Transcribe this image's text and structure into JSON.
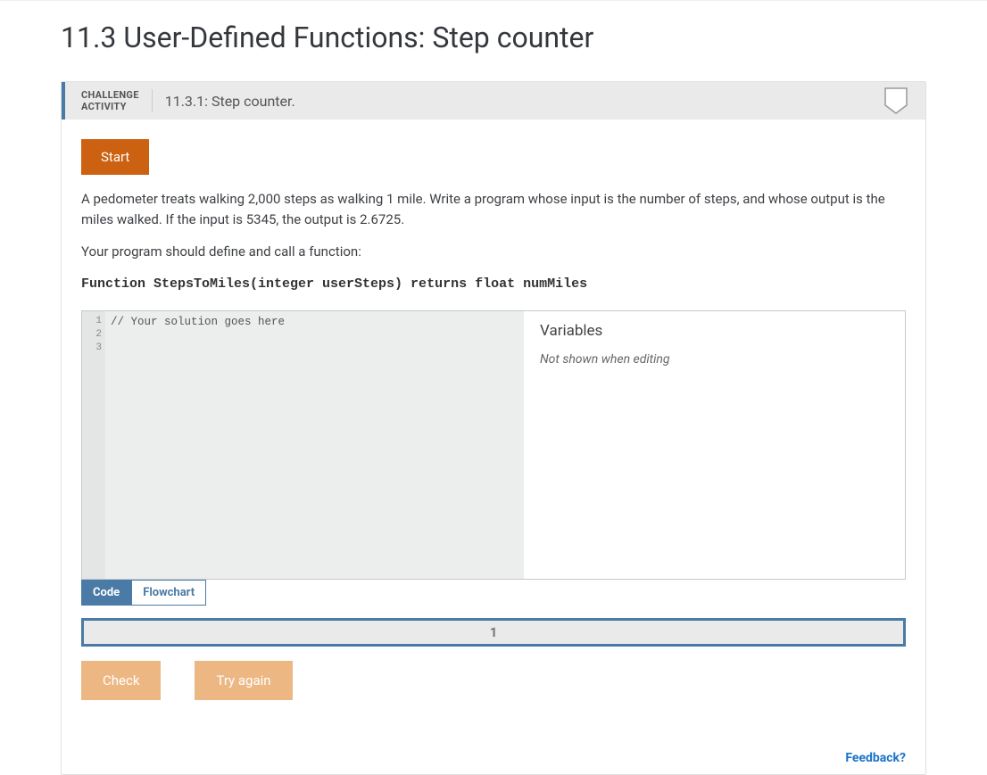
{
  "page": {
    "title": "11.3 User-Defined Functions: Step counter"
  },
  "header": {
    "label_line1": "CHALLENGE",
    "label_line2": "ACTIVITY",
    "subtitle": "11.3.1: Step counter."
  },
  "buttons": {
    "start": "Start",
    "check": "Check",
    "try_again": "Try again"
  },
  "instructions": {
    "p1": "A pedometer treats walking 2,000 steps as walking 1 mile. Write a program whose input is the number of steps, and whose output is the miles walked. If the input is 5345, the output is 2.6725.",
    "p2": "Your program should define and call a function:",
    "signature": "Function StepsToMiles(integer userSteps) returns float numMiles"
  },
  "editor": {
    "gutter": [
      "1",
      "2",
      "3"
    ],
    "lines": [
      "",
      "// Your solution goes here",
      ""
    ]
  },
  "variables": {
    "title": "Variables",
    "note": "Not shown when editing"
  },
  "tabs": {
    "code": "Code",
    "flowchart": "Flowchart"
  },
  "progress": {
    "step": "1"
  },
  "feedback": {
    "label": "Feedback?"
  }
}
